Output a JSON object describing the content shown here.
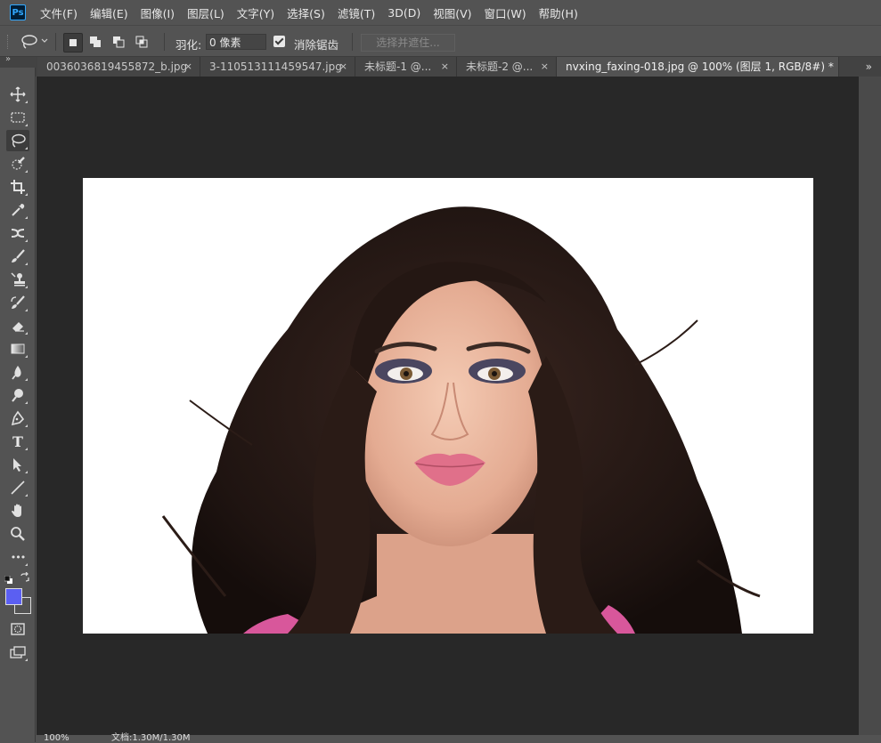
{
  "app": {
    "logo": "Ps"
  },
  "menu": [
    "文件(F)",
    "编辑(E)",
    "图像(I)",
    "图层(L)",
    "文字(Y)",
    "选择(S)",
    "滤镜(T)",
    "3D(D)",
    "视图(V)",
    "窗口(W)",
    "帮助(H)"
  ],
  "options": {
    "feather_label": "羽化:",
    "feather_value": "0 像素",
    "antialias_label": "消除锯齿",
    "antialias_checked": true,
    "select_mask_label": "选择并遮住..."
  },
  "tabs": [
    {
      "label": "0036036819455872_b.jpg",
      "close": "×",
      "active": false
    },
    {
      "label": "3-110513111459547.jpg",
      "close": "×",
      "active": false
    },
    {
      "label": "未标题-1 @...",
      "close": "×",
      "active": false
    },
    {
      "label": "未标题-2 @...",
      "close": "×",
      "active": false
    },
    {
      "label": "nvxing_faxing-018.jpg @ 100% (图层 1, RGB/8#) *",
      "close": "",
      "active": true
    }
  ],
  "tab_overflow": "»",
  "panel_collapse": "»",
  "tools": [
    "move-tool",
    "marquee-tool",
    "lasso-tool",
    "quick-selection-tool",
    "crop-tool",
    "eyedropper-tool",
    "healing-brush-tool",
    "brush-tool",
    "clone-stamp-tool",
    "history-brush-tool",
    "eraser-tool",
    "gradient-tool",
    "blur-tool",
    "dodge-tool",
    "pen-tool",
    "type-tool",
    "path-selection-tool",
    "line-tool",
    "hand-tool",
    "zoom-tool",
    "edit-toolbar"
  ],
  "tool_type_glyph": "T",
  "tool_more_glyph": "•••",
  "colors": {
    "foreground": "#5b5ff2",
    "background": "#535353",
    "canvas": "#282828"
  },
  "status": {
    "zoom": "100%",
    "doc": "文档:1.30M/1.30M"
  }
}
